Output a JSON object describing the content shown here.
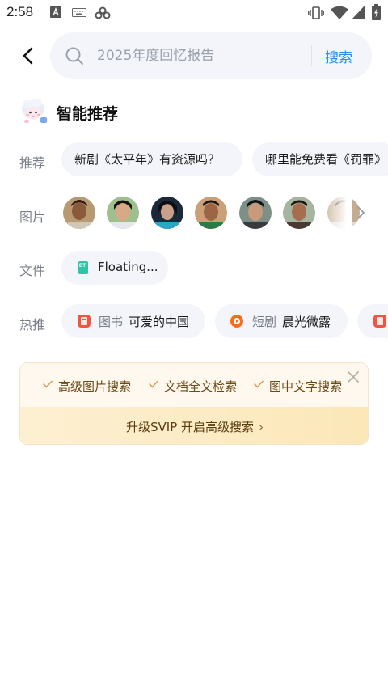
{
  "status_bar": {
    "time": "2:58",
    "left_icons": [
      "font-a-icon",
      "keyboard-icon",
      "cloud-link-icon"
    ],
    "right_icons": [
      "vibrate-icon",
      "wifi-icon",
      "signal-icon",
      "battery-icon"
    ]
  },
  "header": {
    "back_icon": "chevron-left-icon",
    "search": {
      "placeholder": "2025年度回忆报告",
      "value": "",
      "submit_label": "搜索",
      "accent": "#2a8cf5"
    }
  },
  "recommend": {
    "title": "智能推荐",
    "rows": {
      "suggest": {
        "label": "推荐",
        "items": [
          "新剧《太平年》有资源吗？",
          "哪里能免费看《罚罪》"
        ]
      },
      "images": {
        "label": "图片",
        "avatar_count": 7,
        "next_icon": "chevron-right-icon"
      },
      "files": {
        "label": "文件",
        "items": [
          {
            "name": "Floating...",
            "icon": "bt-file-icon",
            "icon_text": "BT"
          }
        ]
      },
      "hot": {
        "label": "热推",
        "items": [
          {
            "category": "图书",
            "title": "可爱的中国",
            "icon": "book-icon",
            "color": "#f2553d"
          },
          {
            "category": "短剧",
            "title": "晨光微露",
            "icon": "short-drama-icon",
            "color": "#ff6a1a"
          }
        ]
      }
    }
  },
  "promo": {
    "features": [
      "高级图片搜索",
      "文档全文检索",
      "图中文字搜索"
    ],
    "cta": "升级SVIP 开启高级搜索",
    "close_icon": "close-icon"
  }
}
